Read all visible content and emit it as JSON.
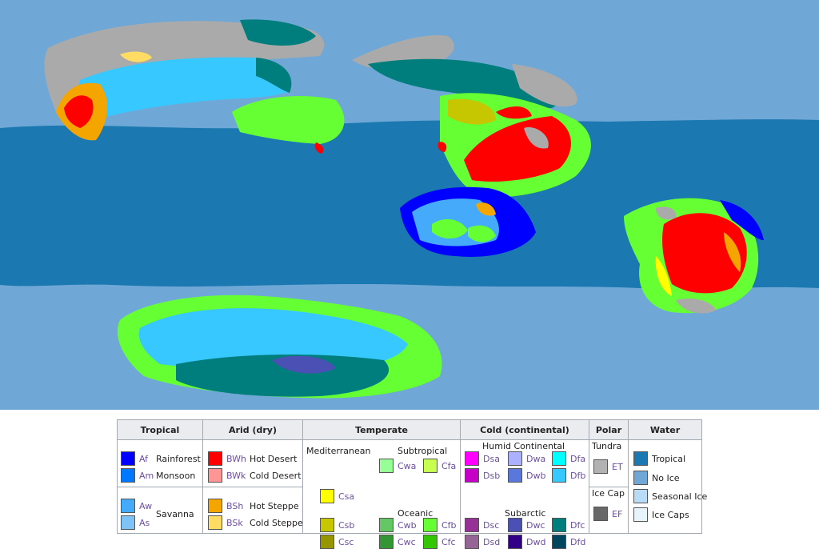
{
  "colors": {
    "sea_light": "#6fa8d6",
    "sea_tropical": "#1b78b0",
    "ice_cap": "#aaaaaa",
    "Af": "#0000fe",
    "Am": "#0078ff",
    "Aw": "#46aafa",
    "As": "#7dc3f5",
    "BWh": "#ff0000",
    "BWk": "#ff9696",
    "BSh": "#f5a500",
    "BSk": "#ffdc64",
    "Csa": "#ffff00",
    "Csb": "#c6c700",
    "Csc": "#969600",
    "Cwa": "#96ff96",
    "Cwb": "#63c764",
    "Cwc": "#329633",
    "Cfa": "#c6ff4e",
    "Cfb": "#66ff33",
    "Cfc": "#33c701",
    "Dsa": "#ff00ff",
    "Dsb": "#c600c7",
    "Dsc": "#963296",
    "Dsd": "#966495",
    "Dwa": "#abb1ff",
    "Dwb": "#5a77db",
    "Dwc": "#4b50b4",
    "Dwd": "#320087",
    "Dfa": "#00ffff",
    "Dfb": "#37c8ff",
    "Dfc": "#007e7d",
    "Dfd": "#00455e",
    "ET": "#b2b2b2",
    "EF": "#686868",
    "w_tropical": "#1b78b0",
    "w_noice": "#6fa8d6",
    "w_seasonal": "#b8dcf5",
    "w_icecaps": "#e8f4fb"
  },
  "legend": {
    "headers": {
      "tropical": "Tropical",
      "arid": "Arid (dry)",
      "temperate": "Temperate",
      "cold": "Cold (continental)",
      "polar": "Polar",
      "water": "Water"
    },
    "tropical": {
      "Af": "Af",
      "Am": "Am",
      "Aw": "Aw",
      "As": "As",
      "rainforest": "Rainforest",
      "monsoon": "Monsoon",
      "savanna": "Savanna"
    },
    "arid": {
      "BWh": "BWh",
      "BWk": "BWk",
      "BSh": "BSh",
      "BSk": "BSk",
      "hot_desert": "Hot Desert",
      "cold_desert": "Cold Desert",
      "hot_steppe": "Hot Steppe",
      "cold_steppe": "Cold Steppe"
    },
    "temperate": {
      "mediterranean": "Mediterranean",
      "subtropical": "Subtropical",
      "oceanic": "Oceanic",
      "Csa": "Csa",
      "Csb": "Csb",
      "Csc": "Csc",
      "Cwa": "Cwa",
      "Cfa": "Cfa",
      "Cwb": "Cwb",
      "Cfb": "Cfb",
      "Cwc": "Cwc",
      "Cfc": "Cfc"
    },
    "cold": {
      "humid_continental": "Humid Continental",
      "subarctic": "Subarctic",
      "Dsa": "Dsa",
      "Dwa": "Dwa",
      "Dfa": "Dfa",
      "Dsb": "Dsb",
      "Dwb": "Dwb",
      "Dfb": "Dfb",
      "Dsc": "Dsc",
      "Dwc": "Dwc",
      "Dfc": "Dfc",
      "Dsd": "Dsd",
      "Dwd": "Dwd",
      "Dfd": "Dfd"
    },
    "polar": {
      "tundra": "Tundra",
      "ET": "ET",
      "ice_cap": "Ice Cap",
      "EF": "EF"
    },
    "water": {
      "tropical": "Tropical",
      "no_ice": "No Ice",
      "seasonal_ice": "Seasonal Ice",
      "ice_caps": "Ice Caps"
    }
  }
}
